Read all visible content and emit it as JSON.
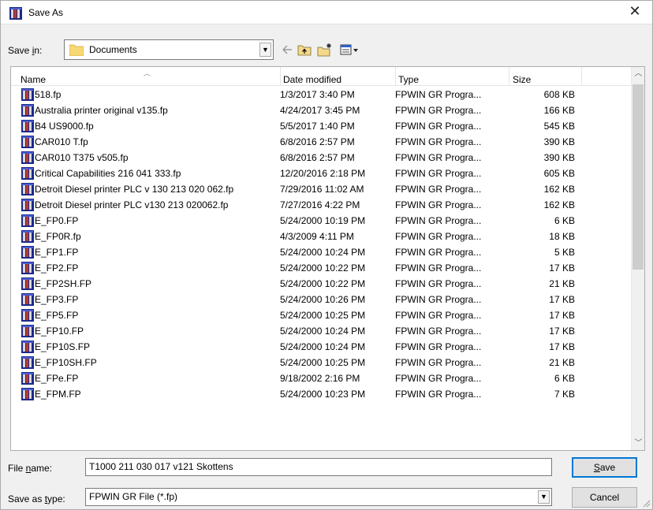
{
  "window": {
    "title": "Save As",
    "close_glyph": "✕"
  },
  "toolbar": {
    "save_in_label": "Save in:",
    "save_in_value": "Documents",
    "icons": [
      "back-arrow-icon",
      "up-folder-icon",
      "new-folder-icon",
      "view-menu-icon"
    ]
  },
  "columns": {
    "name": "Name",
    "date": "Date modified",
    "type": "Type",
    "size": "Size"
  },
  "files": [
    {
      "name": "518.fp",
      "date": "1/3/2017 3:40 PM",
      "type": "FPWIN GR Progra...",
      "size": "608 KB"
    },
    {
      "name": "Australia printer original v135.fp",
      "date": "4/24/2017 3:45 PM",
      "type": "FPWIN GR Progra...",
      "size": "166 KB"
    },
    {
      "name": "B4 US9000.fp",
      "date": "5/5/2017 1:40 PM",
      "type": "FPWIN GR Progra...",
      "size": "545 KB"
    },
    {
      "name": "CAR010 T.fp",
      "date": "6/8/2016 2:57 PM",
      "type": "FPWIN GR Progra...",
      "size": "390 KB"
    },
    {
      "name": "CAR010 T375 v505.fp",
      "date": "6/8/2016 2:57 PM",
      "type": "FPWIN GR Progra...",
      "size": "390 KB"
    },
    {
      "name": "Critical Capabilities 216 041 333.fp",
      "date": "12/20/2016 2:18 PM",
      "type": "FPWIN GR Progra...",
      "size": "605 KB"
    },
    {
      "name": "Detroit Diesel printer PLC v 130 213 020 062.fp",
      "date": "7/29/2016 11:02 AM",
      "type": "FPWIN GR Progra...",
      "size": "162 KB"
    },
    {
      "name": "Detroit Diesel printer PLC v130 213 020062.fp",
      "date": "7/27/2016 4:22 PM",
      "type": "FPWIN GR Progra...",
      "size": "162 KB"
    },
    {
      "name": "E_FP0.FP",
      "date": "5/24/2000 10:19 PM",
      "type": "FPWIN GR Progra...",
      "size": "6 KB"
    },
    {
      "name": "E_FP0R.fp",
      "date": "4/3/2009 4:11 PM",
      "type": "FPWIN GR Progra...",
      "size": "18 KB"
    },
    {
      "name": "E_FP1.FP",
      "date": "5/24/2000 10:24 PM",
      "type": "FPWIN GR Progra...",
      "size": "5 KB"
    },
    {
      "name": "E_FP2.FP",
      "date": "5/24/2000 10:22 PM",
      "type": "FPWIN GR Progra...",
      "size": "17 KB"
    },
    {
      "name": "E_FP2SH.FP",
      "date": "5/24/2000 10:22 PM",
      "type": "FPWIN GR Progra...",
      "size": "21 KB"
    },
    {
      "name": "E_FP3.FP",
      "date": "5/24/2000 10:26 PM",
      "type": "FPWIN GR Progra...",
      "size": "17 KB"
    },
    {
      "name": "E_FP5.FP",
      "date": "5/24/2000 10:25 PM",
      "type": "FPWIN GR Progra...",
      "size": "17 KB"
    },
    {
      "name": "E_FP10.FP",
      "date": "5/24/2000 10:24 PM",
      "type": "FPWIN GR Progra...",
      "size": "17 KB"
    },
    {
      "name": "E_FP10S.FP",
      "date": "5/24/2000 10:24 PM",
      "type": "FPWIN GR Progra...",
      "size": "17 KB"
    },
    {
      "name": "E_FP10SH.FP",
      "date": "5/24/2000 10:25 PM",
      "type": "FPWIN GR Progra...",
      "size": "21 KB"
    },
    {
      "name": "E_FPe.FP",
      "date": "9/18/2002 2:16 PM",
      "type": "FPWIN GR Progra...",
      "size": "6 KB"
    },
    {
      "name": "E_FPM.FP",
      "date": "5/24/2000 10:23 PM",
      "type": "FPWIN GR Progra...",
      "size": "7 KB"
    }
  ],
  "footer": {
    "file_name_label": "File name:",
    "file_name_value": "T1000 211 030 017 v121 Skottens",
    "save_as_type_label": "Save as type:",
    "save_as_type_value": "FPWIN GR File (*.fp)",
    "save_label": "Save",
    "cancel_label": "Cancel"
  },
  "colors": {
    "accent": "#0078d7",
    "folder": "#f8d775"
  }
}
